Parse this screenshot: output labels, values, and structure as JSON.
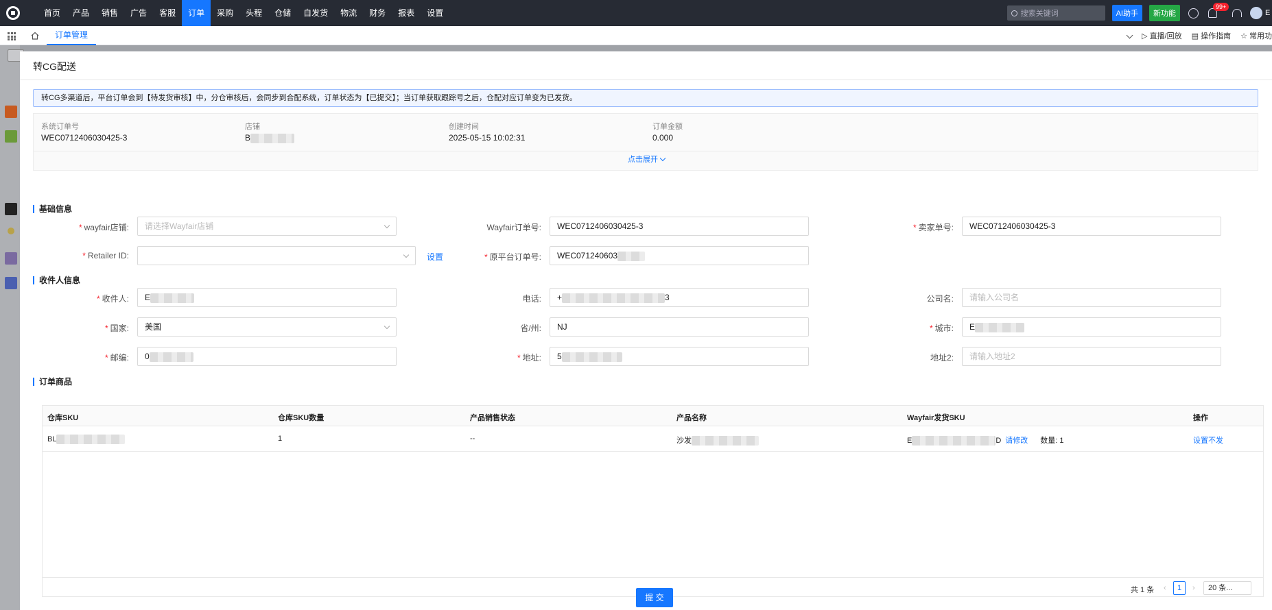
{
  "nav": {
    "items": [
      "首页",
      "产品",
      "销售",
      "广告",
      "客服",
      "订单",
      "采购",
      "头程",
      "仓储",
      "自发货",
      "物流",
      "财务",
      "报表",
      "设置"
    ],
    "active_index": 5,
    "search_placeholder": "搜索关键词",
    "ai_label": "AI助手",
    "new_label": "新功能",
    "badge": "99+",
    "user_initial": "E"
  },
  "tabbar": {
    "tab_label": "订单管理",
    "live_label": "直播/回放",
    "guide_label": "操作指南",
    "common_label": "常用功"
  },
  "modal": {
    "title": "转CG配送",
    "alert": "转CG多渠道后，平台订单会到【待发货审核】中，分仓审核后，会同步到合配系统，订单状态为【已提交】；当订单获取跟踪号之后，仓配对应订单变为已发货。",
    "summary": {
      "order_no_label": "系统订单号",
      "order_no": "WEC0712406030425-3",
      "shop_label": "店铺",
      "shop_value": "B",
      "created_label": "创建时间",
      "created_value": "2025-05-15 10:02:31",
      "amount_label": "订单金额",
      "amount_value": "0.000",
      "expand_label": "点击展开"
    },
    "basic": {
      "section": "基础信息",
      "wayfair_shop_label": "wayfair店铺:",
      "wayfair_shop_placeholder": "请选择Wayfair店铺",
      "wayfair_order_label": "Wayfair订单号:",
      "wayfair_order_value": "WEC0712406030425-3",
      "seller_no_label": "卖家单号:",
      "seller_no_value": "WEC0712406030425-3",
      "retailer_label": "Retailer ID:",
      "retailer_value": "",
      "setting_link": "设置",
      "original_order_label": "原平台订单号:",
      "original_order_value": "WEC071240603"
    },
    "receiver": {
      "section": "收件人信息",
      "name_label": "收件人:",
      "name_value": "E",
      "phone_label": "电话:",
      "phone_value": "+",
      "phone_tail": "3",
      "company_label": "公司名:",
      "company_placeholder": "请输入公司名",
      "country_label": "国家:",
      "country_value": "美国",
      "state_label": "省/州:",
      "state_value": "NJ",
      "city_label": "城市:",
      "city_value": "E",
      "zip_label": "邮编:",
      "zip_value": "0",
      "address_label": "地址:",
      "address_value": "5",
      "address2_label": "地址2:",
      "address2_placeholder": "请输入地址2"
    },
    "goods": {
      "section": "订单商品",
      "columns": [
        "仓库SKU",
        "仓库SKU数量",
        "产品销售状态",
        "产品名称",
        "Wayfair发货SKU",
        "操作"
      ],
      "row": {
        "sku": "BL",
        "qty": "1",
        "status": "--",
        "name": "沙发",
        "wayfair_sku_prefix": "E",
        "wayfair_sku_suffix": "D",
        "modify_link": "请修改",
        "qty_label": "数量: 1",
        "action": "设置不发"
      },
      "pager": {
        "total": "共 1 条",
        "page": "1",
        "size": "20 条..."
      }
    },
    "submit_label": "提 交"
  }
}
